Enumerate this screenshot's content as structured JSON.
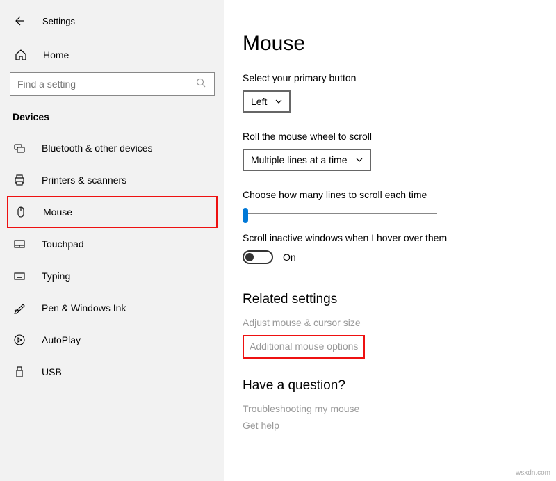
{
  "app": {
    "title": "Settings"
  },
  "home": {
    "label": "Home"
  },
  "search": {
    "placeholder": "Find a setting"
  },
  "category": "Devices",
  "nav": [
    {
      "label": "Bluetooth & other devices"
    },
    {
      "label": "Printers & scanners"
    },
    {
      "label": "Mouse"
    },
    {
      "label": "Touchpad"
    },
    {
      "label": "Typing"
    },
    {
      "label": "Pen & Windows Ink"
    },
    {
      "label": "AutoPlay"
    },
    {
      "label": "USB"
    }
  ],
  "page": {
    "title": "Mouse",
    "primary_label": "Select your primary button",
    "primary_value": "Left",
    "scroll_label": "Roll the mouse wheel to scroll",
    "scroll_value": "Multiple lines at a time",
    "lines_label": "Choose how many lines to scroll each time",
    "hover_label": "Scroll inactive windows when I hover over them",
    "hover_state": "On",
    "related_title": "Related settings",
    "related_link1": "Adjust mouse & cursor size",
    "related_link2": "Additional mouse options",
    "question_title": "Have a question?",
    "question_link1": "Troubleshooting my mouse",
    "question_link2": "Get help"
  },
  "watermark": "wsxdn.com"
}
